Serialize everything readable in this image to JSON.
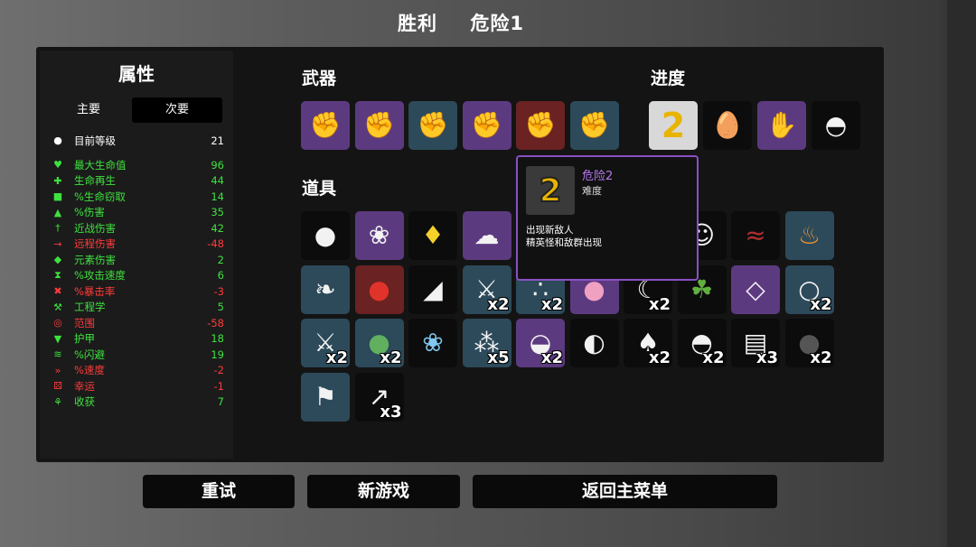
{
  "header": {
    "result": "胜利",
    "danger": "危险1"
  },
  "stats_panel": {
    "title": "属性",
    "tab_primary": "主要",
    "tab_secondary": "次要",
    "level": {
      "label": "目前等级",
      "value": "21"
    },
    "stats": [
      {
        "label": "最大生命值",
        "value": "96",
        "tone": "green",
        "icon": "heart-icon"
      },
      {
        "label": "生命再生",
        "value": "44",
        "tone": "green",
        "icon": "regen-icon"
      },
      {
        "label": "%生命窃取",
        "value": "14",
        "tone": "green",
        "icon": "lifesteal-icon"
      },
      {
        "label": "%伤害",
        "value": "35",
        "tone": "green",
        "icon": "damage-icon"
      },
      {
        "label": "近战伤害",
        "value": "42",
        "tone": "green",
        "icon": "melee-icon"
      },
      {
        "label": "远程伤害",
        "value": "-48",
        "tone": "red",
        "icon": "ranged-icon"
      },
      {
        "label": "元素伤害",
        "value": "2",
        "tone": "green",
        "icon": "elemental-icon"
      },
      {
        "label": "%攻击速度",
        "value": "6",
        "tone": "green",
        "icon": "attack-speed-icon"
      },
      {
        "label": "%暴击率",
        "value": "-3",
        "tone": "red",
        "icon": "crit-icon"
      },
      {
        "label": "工程学",
        "value": "5",
        "tone": "green",
        "icon": "engineering-icon"
      },
      {
        "label": "范围",
        "value": "-58",
        "tone": "red",
        "icon": "range-icon"
      },
      {
        "label": "护甲",
        "value": "18",
        "tone": "green",
        "icon": "armor-icon"
      },
      {
        "label": "%闪避",
        "value": "19",
        "tone": "green",
        "icon": "dodge-icon"
      },
      {
        "label": "%速度",
        "value": "-2",
        "tone": "red",
        "icon": "speed-icon"
      },
      {
        "label": "幸运",
        "value": "-1",
        "tone": "red",
        "icon": "luck-icon"
      },
      {
        "label": "收获",
        "value": "7",
        "tone": "green",
        "icon": "harvest-icon"
      }
    ]
  },
  "weapons": {
    "title": "武器",
    "items": [
      {
        "icon": "fist-icon",
        "tier": "purple"
      },
      {
        "icon": "fist-icon",
        "tier": "purple"
      },
      {
        "icon": "fist-icon",
        "tier": "teal"
      },
      {
        "icon": "fist-icon",
        "tier": "purple"
      },
      {
        "icon": "fist-icon",
        "tier": "red"
      },
      {
        "icon": "fist-icon",
        "tier": "teal"
      }
    ]
  },
  "progress": {
    "title": "进度",
    "items": [
      {
        "icon": "danger-2-icon",
        "tier": "white"
      },
      {
        "icon": "egg-character-icon",
        "tier": "black"
      },
      {
        "icon": "gauntlet-icon",
        "tier": "purple"
      },
      {
        "icon": "ufo-icon",
        "tier": "black"
      }
    ]
  },
  "items": {
    "title": "道具",
    "rows": [
      [
        {
          "icon": "egg-face-icon",
          "tier": "black",
          "qty": ""
        },
        {
          "icon": "tardigrade-icon",
          "tier": "purple",
          "qty": ""
        },
        {
          "icon": "duck-icon",
          "tier": "black",
          "qty": ""
        },
        {
          "icon": "ghost-icon",
          "tier": "purple",
          "qty": ""
        },
        {
          "icon": "face-icon",
          "tier": "black",
          "qty": ""
        },
        {
          "icon": "snake-icon",
          "tier": "black",
          "qty": ""
        },
        {
          "icon": "campfire-icon",
          "tier": "teal",
          "qty": ""
        }
      ],
      [
        {
          "icon": "belt-icon",
          "tier": "teal",
          "qty": ""
        },
        {
          "icon": "tomato-icon",
          "tier": "red",
          "qty": ""
        },
        {
          "icon": "cake-icon",
          "tier": "black",
          "qty": ""
        },
        {
          "icon": "claw-icon",
          "tier": "teal",
          "qty": "x2"
        },
        {
          "icon": "dots-icon",
          "tier": "teal",
          "qty": "x2"
        },
        {
          "icon": "pink-blob-icon",
          "tier": "purple",
          "qty": ""
        },
        {
          "icon": "scythe-icon",
          "tier": "black",
          "qty": "x2"
        },
        {
          "icon": "sprout-icon",
          "tier": "black",
          "qty": ""
        },
        {
          "icon": "gem-icon",
          "tier": "purple",
          "qty": ""
        },
        {
          "icon": "pendant-icon",
          "tier": "teal",
          "qty": "x2"
        }
      ],
      [
        {
          "icon": "broken-blade-icon",
          "tier": "teal",
          "qty": "x2"
        },
        {
          "icon": "frog-icon",
          "tier": "teal",
          "qty": "x2"
        },
        {
          "icon": "butterfly-icon",
          "tier": "black",
          "qty": ""
        },
        {
          "icon": "larva-icon",
          "tier": "teal",
          "qty": "x5"
        },
        {
          "icon": "helmet-icon",
          "tier": "purple",
          "qty": "x2"
        },
        {
          "icon": "bandage-icon",
          "tier": "black",
          "qty": ""
        },
        {
          "icon": "mushroom-icon",
          "tier": "black",
          "qty": "x2"
        },
        {
          "icon": "ufo-small-icon",
          "tier": "black",
          "qty": "x2"
        },
        {
          "icon": "map-icon",
          "tier": "black",
          "qty": "x3"
        },
        {
          "icon": "coal-icon",
          "tier": "black",
          "qty": "x2"
        }
      ],
      [
        {
          "icon": "flag-icon",
          "tier": "teal",
          "qty": ""
        },
        {
          "icon": "syringe-icon",
          "tier": "black",
          "qty": "x3"
        }
      ]
    ]
  },
  "tooltip": {
    "icon_text": "2",
    "name": "危险2",
    "subtitle": "难度",
    "line1": "出现新敌人",
    "line2": "精英怪和敌群出现"
  },
  "buttons": {
    "retry": "重试",
    "new_game": "新游戏",
    "main_menu": "返回主菜单"
  }
}
